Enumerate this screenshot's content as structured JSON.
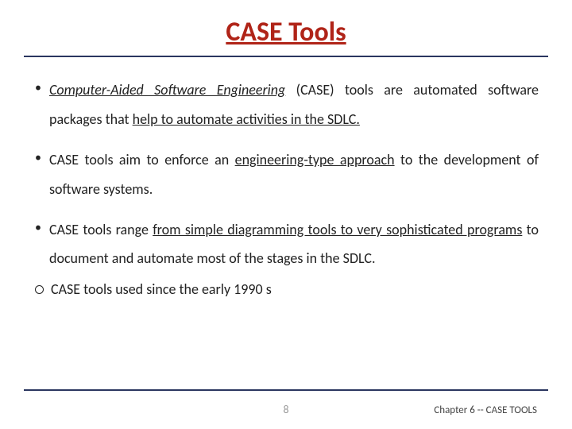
{
  "title": "CASE Tools",
  "bullets": {
    "b1_pre": "",
    "b1_em": "Computer-Aided Software Engineering",
    "b1_post": " (CASE) tools are automated software packages that ",
    "b1_u": "help to automate activities in the SDLC.",
    "b2_pre": "CASE tools aim to enforce an ",
    "b2_u": "engineering-type approach",
    "b2_post": " to the development of software systems.",
    "b3_pre": "CASE tools range ",
    "b3_u": "from simple diagramming tools to very sophisticated programs",
    "b3_post": " to document and automate most of the stages in the SDLC.",
    "sub1": "CASE tools used since the early 1990 s"
  },
  "page_number": "8",
  "chapter_label": "Chapter 6 -- CASE TOOLS"
}
